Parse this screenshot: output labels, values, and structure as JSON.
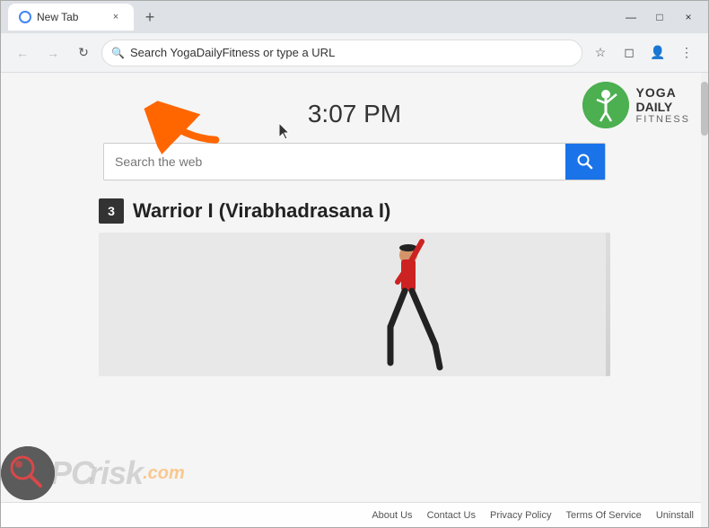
{
  "browser": {
    "tab_title": "New Tab",
    "tab_close": "×",
    "new_tab": "+",
    "window_minimize": "—",
    "window_maximize": "□",
    "window_close": "×"
  },
  "address_bar": {
    "url_placeholder": "Search YogaDailyFitness or type a URL",
    "bookmark_icon": "☆",
    "extensions_icon": "◻",
    "profile_icon": "👤",
    "menu_icon": "⋮",
    "back_icon": "←",
    "forward_icon": "→",
    "refresh_icon": "↻"
  },
  "logo": {
    "yoga": "YOGA",
    "daily": "DAILY",
    "fitness": "FITNESS"
  },
  "time": {
    "display": "3:07 PM"
  },
  "search": {
    "placeholder": "Search the web",
    "button_label": "Search"
  },
  "article": {
    "number": "3",
    "title": "Warrior I (Virabhadrasana I)"
  },
  "footer": {
    "links": [
      "About Us",
      "Contact Us",
      "Privacy Policy",
      "Terms Of Service",
      "Uninstall"
    ]
  },
  "watermark": {
    "pc": "PC",
    "risk": "risk",
    "com": ".com"
  }
}
